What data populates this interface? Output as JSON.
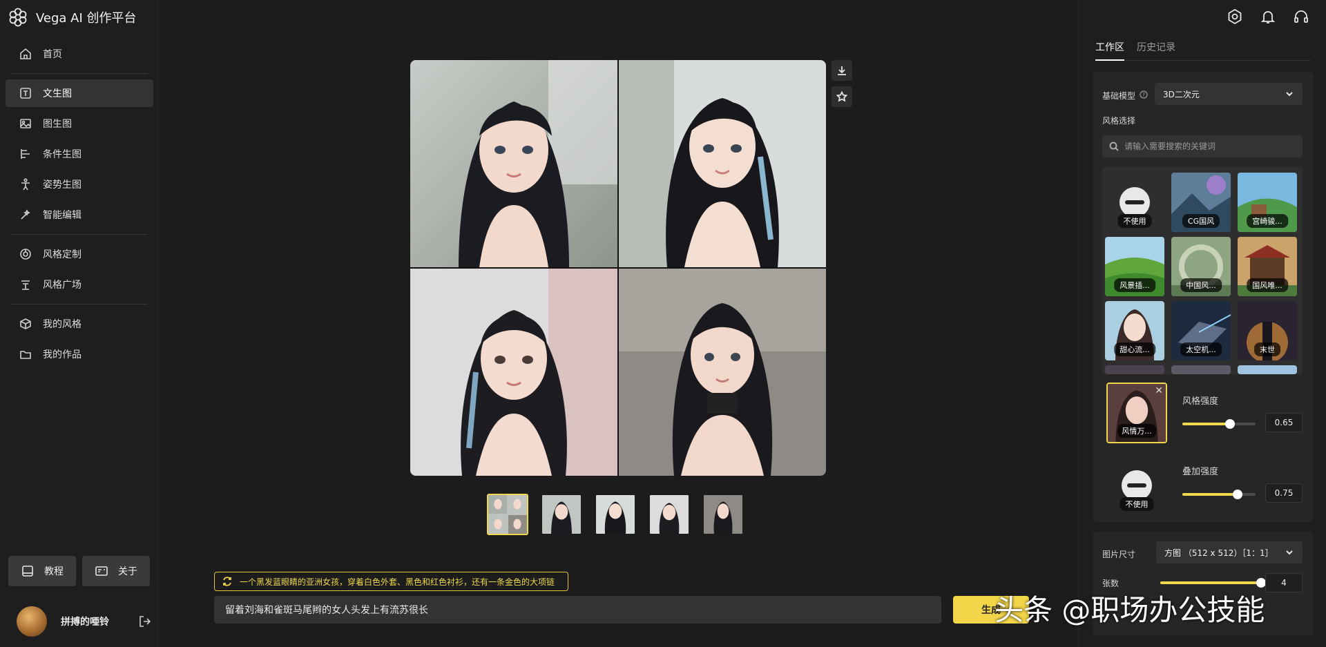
{
  "app": {
    "title": "Vega AI 创作平台"
  },
  "nav": {
    "items": [
      {
        "label": "首页",
        "icon": "home-icon"
      },
      {
        "label": "文生图",
        "icon": "text-to-image-icon"
      },
      {
        "label": "图生图",
        "icon": "image-to-image-icon"
      },
      {
        "label": "条件生图",
        "icon": "condition-icon"
      },
      {
        "label": "姿势生图",
        "icon": "pose-icon"
      },
      {
        "label": "智能编辑",
        "icon": "magic-edit-icon"
      },
      {
        "label": "风格定制",
        "icon": "style-custom-icon"
      },
      {
        "label": "风格广场",
        "icon": "style-square-icon"
      },
      {
        "label": "我的风格",
        "icon": "my-style-icon"
      },
      {
        "label": "我的作品",
        "icon": "my-works-icon"
      }
    ],
    "active_index": 1
  },
  "footer": {
    "tutorial_label": "教程",
    "about_label": "关于"
  },
  "user": {
    "name": "拼搏的唖铃"
  },
  "prompt": {
    "suggestion": "一个黑发蓝眼睛的亚洲女孩，穿着白色外套、黑色和红色衬衫，还有一条金色的大项链",
    "value": "留着刘海和雀斑马尾辫的女人头发上有流苏很长",
    "generate_label": "生成"
  },
  "watermark": "头条 @职场办公技能",
  "right": {
    "tabs": [
      "工作区",
      "历史记录"
    ],
    "active_tab": 0,
    "base_model_label": "基础模型",
    "base_model_value": "3D二次元",
    "style_select_label": "风格选择",
    "search_placeholder": "请输入需要搜索的关键词",
    "styles": [
      "不使用",
      "CG国风",
      "宫崎骏...",
      "风景插...",
      "中国风...",
      "国风唯...",
      "甜心流...",
      "太空机...",
      "末世"
    ],
    "selected_style": "风情万...",
    "style_strength_label": "风格强度",
    "style_strength": 0.65,
    "overlay_none_label": "不使用",
    "overlay_strength_label": "叠加强度",
    "overlay_strength": 0.75,
    "image_size_label": "图片尺寸",
    "image_size_value": "方图 （512 x 512）［1：1］",
    "count_label": "张数",
    "count": 4
  }
}
